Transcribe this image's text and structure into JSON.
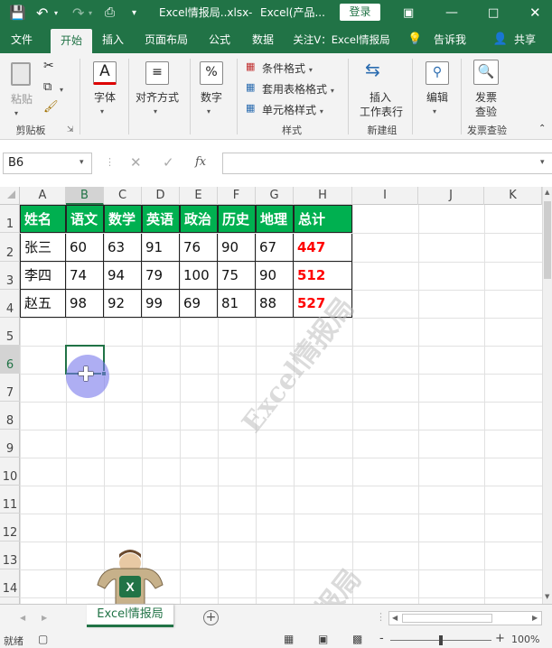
{
  "titlebar": {
    "filename": "Excel情报局..xlsx",
    "separator": "-",
    "app": "Excel(产品...",
    "login": "登录"
  },
  "tabs": [
    "文件",
    "开始",
    "插入",
    "页面布局",
    "公式",
    "数据",
    "关注V：Excel情报局",
    "告诉我",
    "共享"
  ],
  "ribbon": {
    "paste": "粘贴",
    "clipboard": "剪贴板",
    "font": "字体",
    "align": "对齐方式",
    "number": "数字",
    "cond_format": "条件格式",
    "table_format": "套用表格格式",
    "cell_style": "单元格样式",
    "style_group": "样式",
    "insert_table": "插入工作表行",
    "insert_line1": "插入",
    "insert_line2": "工作表行",
    "new_group": "新建组",
    "edit": "编辑",
    "inv_line1": "发票",
    "inv_line2": "查验",
    "inv_group": "发票查验",
    "pct": "%",
    "fontA": "A"
  },
  "formula_bar": {
    "namebox": "B6",
    "fx": "fx",
    "content": ""
  },
  "grid": {
    "columns": [
      "A",
      "B",
      "C",
      "D",
      "E",
      "F",
      "G",
      "H",
      "I",
      "J",
      "K"
    ],
    "rows": [
      "1",
      "2",
      "3",
      "4",
      "5",
      "6",
      "7",
      "8",
      "9",
      "10",
      "11",
      "12",
      "13",
      "14"
    ],
    "header": [
      "姓名",
      "语文",
      "数学",
      "英语",
      "政治",
      "历史",
      "地理",
      "总计"
    ],
    "data": [
      [
        "张三",
        "60",
        "63",
        "91",
        "76",
        "90",
        "67",
        "447"
      ],
      [
        "李四",
        "74",
        "94",
        "79",
        "100",
        "75",
        "90",
        "512"
      ],
      [
        "赵五",
        "98",
        "92",
        "99",
        "69",
        "81",
        "88",
        "527"
      ]
    ],
    "selected_cell": "B6"
  },
  "sheet": {
    "tab_name": "Excel情报局",
    "add": "+"
  },
  "status": {
    "ready": "就绪",
    "zoom": "100%",
    "minus": "-",
    "plus": "+"
  },
  "watermark": "Excel情报局",
  "watermark2": "情报局",
  "colors": {
    "excel_green": "#217346",
    "header_fill": "#00b050",
    "total_text": "#ff0000",
    "cursor_blob": "#8080ee"
  }
}
